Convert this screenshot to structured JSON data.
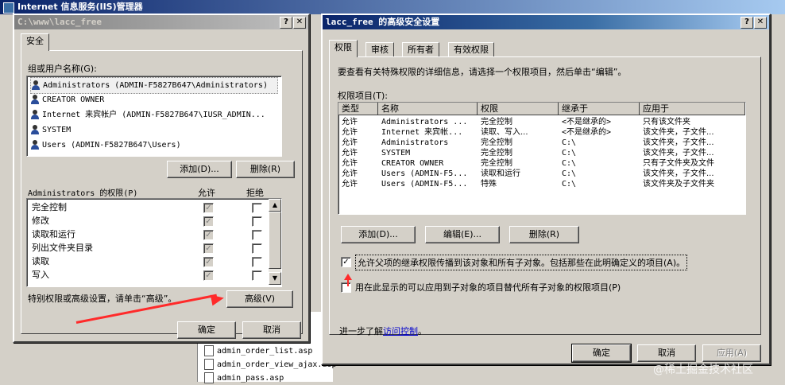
{
  "background_window": {
    "title": "Internet 信息服务(IIS)管理器",
    "files": [
      "admin_order_list.asp",
      "admin_order_view_ajax.asp",
      "admin_pass.asp"
    ]
  },
  "security_dialog": {
    "title": "C:\\www\\lacc_free",
    "tab_security": "安全",
    "group_label": "组或用户名称(G):",
    "users": [
      "Administrators (ADMIN-F5827B647\\Administrators)",
      "CREATOR OWNER",
      "Internet 来宾帐户 (ADMIN-F5827B647\\IUSR_ADMIN...",
      "SYSTEM",
      "Users (ADMIN-F5827B647\\Users)"
    ],
    "add_button": "添加(D)...",
    "remove_button": "删除(R)",
    "perm_label": "Administrators 的权限(P)",
    "allow_header": "允许",
    "deny_header": "拒绝",
    "permissions": [
      "完全控制",
      "修改",
      "读取和运行",
      "列出文件夹目录",
      "读取",
      "写入"
    ],
    "special_text": "特别权限或高级设置，请单击“高级”。",
    "advanced_button": "高级(V)",
    "ok_button": "确定",
    "cancel_button": "取消"
  },
  "advanced_dialog": {
    "title": "lacc_free 的高级安全设置",
    "tabs": [
      "权限",
      "审核",
      "所有者",
      "有效权限"
    ],
    "intro_text": "要查看有关特殊权限的详细信息，请选择一个权限项目，然后单击“编辑”。",
    "entries_label": "权限项目(T):",
    "columns": [
      "类型",
      "名称",
      "权限",
      "继承于",
      "应用于"
    ],
    "rows": [
      [
        "允许",
        "Administrators ...",
        "完全控制",
        "<不是继承的>",
        "只有该文件夹"
      ],
      [
        "允许",
        "Internet 来宾帐...",
        "读取、写入...",
        "<不是继承的>",
        "该文件夹，子文件..."
      ],
      [
        "允许",
        "Administrators",
        "完全控制",
        "C:\\",
        "该文件夹，子文件..."
      ],
      [
        "允许",
        "SYSTEM",
        "完全控制",
        "C:\\",
        "该文件夹，子文件..."
      ],
      [
        "允许",
        "CREATOR OWNER",
        "完全控制",
        "C:\\",
        "只有子文件夹及文件"
      ],
      [
        "允许",
        "Users (ADMIN-F5...",
        "读取和运行",
        "C:\\",
        "该文件夹，子文件..."
      ],
      [
        "允许",
        "Users (ADMIN-F5...",
        "特殊",
        "C:\\",
        "该文件夹及子文件夹"
      ]
    ],
    "add_button": "添加(D)...",
    "edit_button": "编辑(E)...",
    "remove_button": "删除(R)",
    "inherit_checkbox": "允许父项的继承权限传播到该对象和所有子对象。包括那些在此明确定义的项目(A)。",
    "replace_checkbox": "用在此显示的可以应用到子对象的项目替代所有子对象的权限项目(P)",
    "learn_prefix": "进一步了解",
    "learn_link": "访问控制",
    "learn_suffix": "。",
    "ok_button": "确定",
    "cancel_button": "取消",
    "apply_button": "应用(A)"
  },
  "watermark": "@稀土掘金技术社区",
  "colors": {
    "active_title": "#0a246a",
    "annotation_red": "#ff2a2a",
    "link": "#0000cc"
  }
}
